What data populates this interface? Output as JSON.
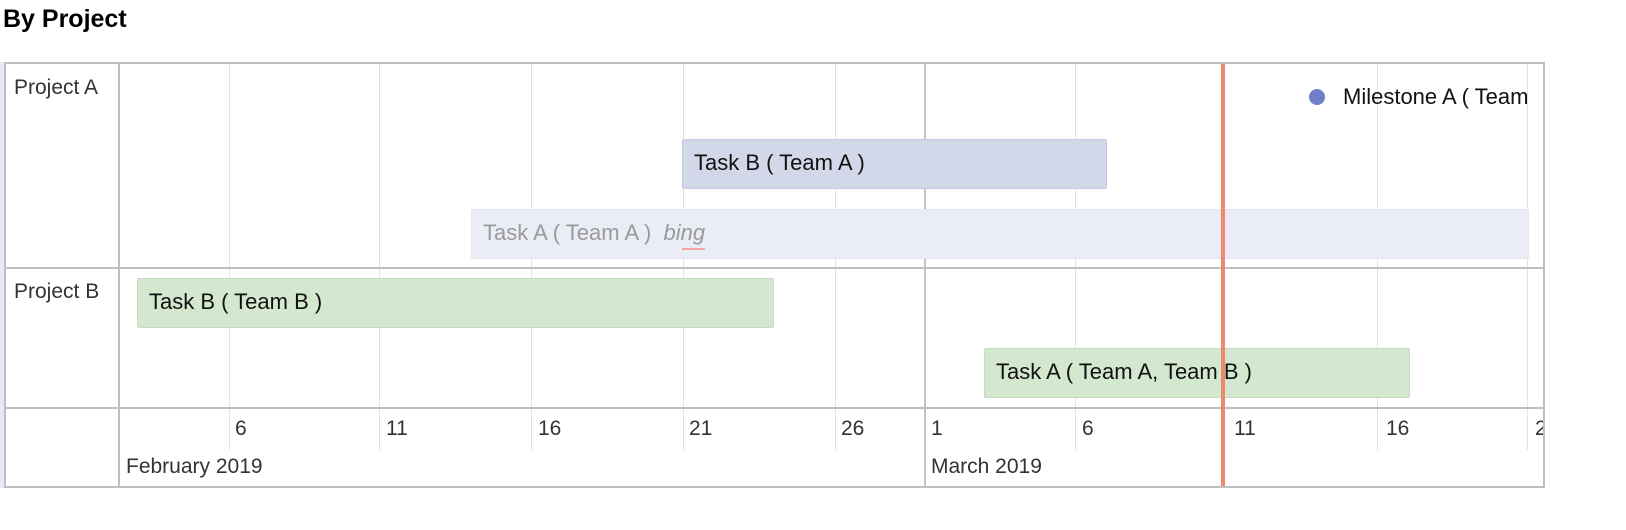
{
  "page": {
    "title": "By Project"
  },
  "groups": [
    {
      "label": "Project A"
    },
    {
      "label": "Project B"
    }
  ],
  "items": {
    "task_b_team_a": {
      "label": "Task B ( Team A )",
      "start": "2019-02-21",
      "end": "2019-03-07"
    },
    "task_a_team_a": {
      "label": "Task A ( Team A )",
      "note": "bing",
      "start": "2019-02-14",
      "end": "2019-03-21"
    },
    "task_b_team_b": {
      "label": "Task B ( Team B )",
      "start": "2019-02-03",
      "end": "2019-02-24"
    },
    "task_a_team_ab": {
      "label": "Task A ( Team A, Team B )",
      "start": "2019-03-03",
      "end": "2019-03-17"
    },
    "milestone_a": {
      "label": "Milestone A ( Team",
      "date": "2019-03-14"
    }
  },
  "axis": {
    "minor_ticks": [
      "6",
      "11",
      "16",
      "21",
      "26",
      "1",
      "6",
      "11",
      "16",
      "2"
    ],
    "months": [
      "February 2019",
      "March 2019"
    ],
    "current_time": "2019-03-11"
  },
  "colors": {
    "team_a_bar": "#d2d8ea",
    "team_a_faded_bar": "#eaedf6",
    "team_b_bar": "#d3e8cf",
    "milestone_dot": "#6f7fc8",
    "current_time_line": "#f0876f"
  }
}
